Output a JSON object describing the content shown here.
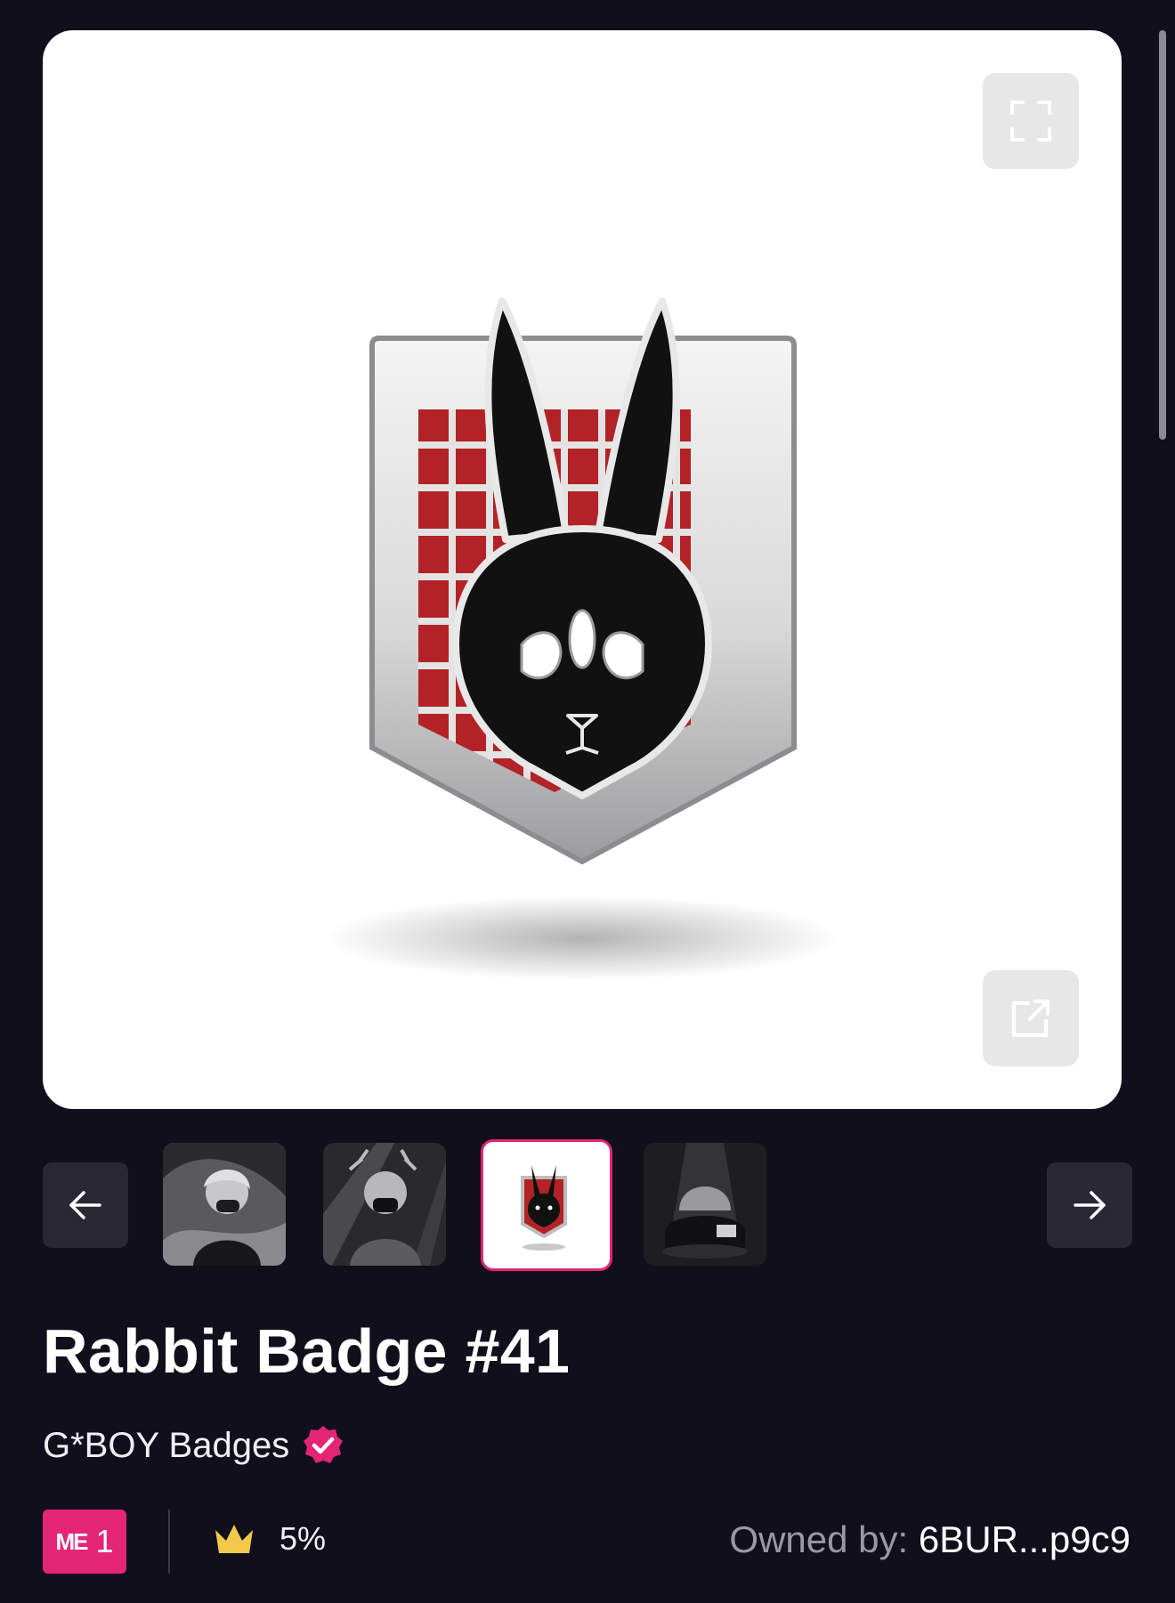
{
  "media": {
    "main_image_alt": "Rabbit Badge #41",
    "expand_icon": "expand-icon",
    "open_external_icon": "external-link-icon"
  },
  "gallery": {
    "prev_icon": "arrow-left-icon",
    "next_icon": "arrow-right-icon",
    "thumbnails": [
      {
        "selected": false
      },
      {
        "selected": false
      },
      {
        "selected": true
      },
      {
        "selected": false
      }
    ]
  },
  "item": {
    "title": "Rabbit Badge #41",
    "collection": "G*BOY Badges",
    "verified_icon": "verified-badge-icon"
  },
  "footer": {
    "marketplace_logo": "ME",
    "marketplace_count": "1",
    "royalty_icon": "crown-icon",
    "royalty_value": "5%",
    "owner_label": "Owned by:",
    "owner_address": "6BUR...p9c9"
  },
  "colors": {
    "background": "#110f1c",
    "accent": "#e42575",
    "badge_red": "#b52327",
    "crown": "#f2c94c"
  }
}
